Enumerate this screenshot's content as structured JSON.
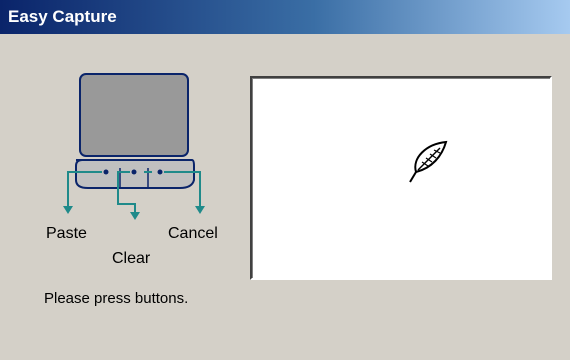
{
  "window": {
    "title": "Easy Capture"
  },
  "device": {
    "buttons": {
      "paste": "Paste",
      "clear": "Clear",
      "cancel": "Cancel"
    }
  },
  "status": {
    "message": "Please press buttons."
  },
  "icons": {
    "signature_area": "feather-pen-icon"
  },
  "colors": {
    "titlebar_start": "#0a246a",
    "titlebar_end": "#a6caf0",
    "device_outline": "#0a246a",
    "arrow": "#1f8a8a",
    "screen_fill": "#999999"
  }
}
